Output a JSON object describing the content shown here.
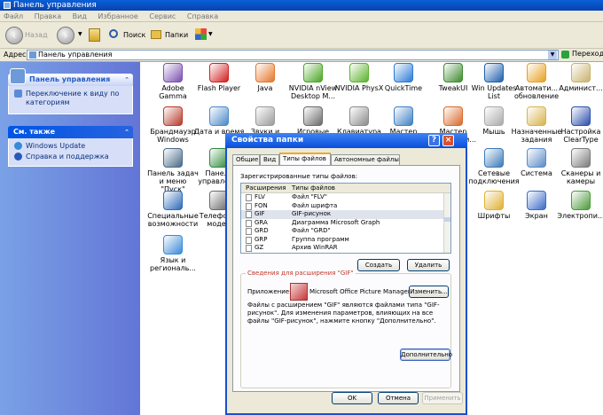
{
  "window": {
    "title": "Панель управления"
  },
  "menu": [
    "Файл",
    "Правка",
    "Вид",
    "Избранное",
    "Сервис",
    "Справка"
  ],
  "toolbar": {
    "back": "Назад",
    "search": "Поиск",
    "folders": "Папки"
  },
  "address": {
    "label": "Адрес:",
    "value": "Панель управления",
    "go": "Переход"
  },
  "sidebar": {
    "panel1": {
      "title": "Панель управления",
      "link": "Переключение к виду по категориям"
    },
    "panel2": {
      "title": "См. также",
      "links": [
        "Windows Update",
        "Справка и поддержка"
      ]
    }
  },
  "items": [
    {
      "label": "Adobe Gamma",
      "color": "#7a4fb0"
    },
    {
      "label": "Flash Player",
      "color": "#d21f1f"
    },
    {
      "label": "Java",
      "color": "#e4762b"
    },
    {
      "label": "NVIDIA nView Desktop M...",
      "color": "#4aa523"
    },
    {
      "label": "NVIDIA PhysX",
      "color": "#5ab22a"
    },
    {
      "label": "QuickTime",
      "color": "#2a7ad5"
    },
    {
      "label": "TweakUI",
      "color": "#3c8a2e"
    },
    {
      "label": "Win Updates List",
      "color": "#1f5fae"
    },
    {
      "label": "Автомати... обновление",
      "color": "#e8a020"
    },
    {
      "label": "Админист...",
      "color": "#c9b26b"
    },
    {
      "label": "Брандмауэр Windows",
      "color": "#b73a2a"
    },
    {
      "label": "Дата и время",
      "color": "#4a88c8"
    },
    {
      "label": "Звуки и аудиоу...",
      "color": "#9a9a9a"
    },
    {
      "label": "Игровые устрой...",
      "color": "#6a6a6a"
    },
    {
      "label": "Клавиатура",
      "color": "#8a8a8a"
    },
    {
      "label": "Мастер беспрово...",
      "color": "#3f7fc4"
    },
    {
      "label": "Мастер настройки...",
      "color": "#d96a2a"
    },
    {
      "label": "Мышь",
      "color": "#aaaaaa"
    },
    {
      "label": "Назначенные задания",
      "color": "#d8b24a"
    },
    {
      "label": "Настройка ClearType",
      "color": "#2a4fae"
    },
    {
      "label": "Панель задач и меню \"Пуск\"",
      "color": "#4a6a8a"
    },
    {
      "label": "Панель управлен...",
      "color": "#2f8a3a"
    },
    {
      "label": "Сетевые подключения",
      "color": "#3a7ab8"
    },
    {
      "label": "Система",
      "color": "#5a8ac8"
    },
    {
      "label": "Сканеры и камеры",
      "color": "#7a7a7a"
    },
    {
      "label": "Специальные возможности",
      "color": "#2a6ab8"
    },
    {
      "label": "Телефон и модем",
      "color": "#6a6a6a"
    },
    {
      "label": "Шрифты",
      "color": "#e0b030"
    },
    {
      "label": "Экран",
      "color": "#3a6ac8"
    },
    {
      "label": "Электропи...",
      "color": "#4a9a3a"
    },
    {
      "label": "Язык и региональ...",
      "color": "#3a8ad8"
    }
  ],
  "dialog": {
    "title": "Свойства папки",
    "help": "?",
    "close": "×",
    "tabs": [
      "Общие",
      "Вид",
      "Типы файлов",
      "Автономные файлы"
    ],
    "registered_label": "Зарегистрированные типы файлов:",
    "columns": [
      "Расширения",
      "Типы файлов"
    ],
    "rows": [
      {
        "ext": "FLV",
        "type": "Файл \"FLV\""
      },
      {
        "ext": "FON",
        "type": "Файл шрифта"
      },
      {
        "ext": "GIF",
        "type": "GIF-рисунок"
      },
      {
        "ext": "GRA",
        "type": "Диаграмма Microsoft Graph"
      },
      {
        "ext": "GRD",
        "type": "Файл \"GRD\""
      },
      {
        "ext": "GRP",
        "type": "Группа программ"
      },
      {
        "ext": "GZ",
        "type": "Архив WinRAR"
      }
    ],
    "create": "Создать",
    "delete": "Удалить",
    "details_title": "Сведения для расширения \"GIF\"",
    "app_label": "Приложение:",
    "app_name": "Microsoft Office Picture Manager",
    "change": "Изменить...",
    "description": "Файлы с расширением \"GIF\" являются файлами типа \"GIF-рисунок\". Для изменения параметров, влияющих на все файлы \"GIF-рисунок\", нажмите кнопку \"Дополнительно\".",
    "advanced": "Дополнительно",
    "ok": "OK",
    "cancel": "Отмена",
    "apply": "Применить"
  }
}
